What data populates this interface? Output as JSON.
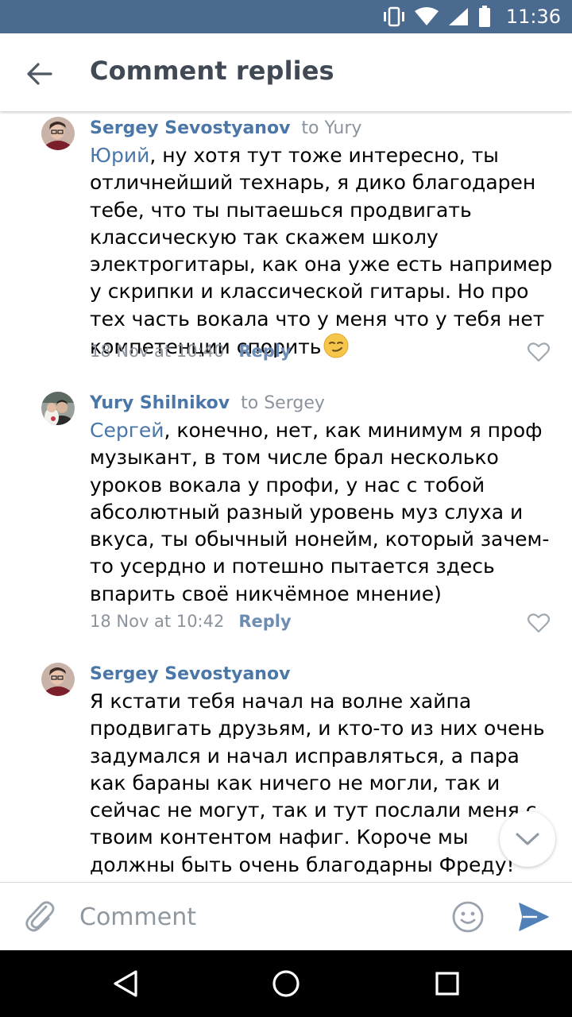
{
  "status_bar": {
    "time": "11:36",
    "background": "#4a6b8f"
  },
  "app_bar": {
    "title": "Comment replies",
    "back_icon": "arrow-left-icon"
  },
  "comments": [
    {
      "author": "Sergey Sevostyanov",
      "to": "to Yury",
      "mention": "Юрий",
      "text": ", ну хотя тут тоже интересно, ты отличнейший технарь, я дико благодарен тебе, что ты пытаешься продвигать классическую так скажем школу электрогитары, как она уже есть например у скрипки и классической гитары. Но про тех часть вокала что у меня что у тебя нет компетенции спорить",
      "emoji": "smirking-face-emoji",
      "date": "18 Nov at 10:40",
      "reply_label": "Reply"
    },
    {
      "author": "Yury Shilnikov",
      "to": "to Sergey",
      "mention": "Сергей",
      "text": ", конечно, нет, как минимум я проф музыкант, в том числе брал несколько уроков вокала у профи, у нас с тобой абсолютный разный уровень муз слуха и вкуса, ты обычный нонейм, который зачем-то усердно и потешно пытается здесь впарить своё никчёмное мнение)",
      "date": "18 Nov at 10:42",
      "reply_label": "Reply"
    },
    {
      "author": "Sergey Sevostyanov",
      "text": "Я кстати тебя начал на волне хайпа продвигать друзьям, и кто-то из них очень задумался и начал исправляться, а пара как бараны как ничего не могли, так и сейчас не могут, так и тут послали меня с твоим контентом нафиг. Короче мы должны быть очень благодарны Фреду!"
    }
  ],
  "composer": {
    "placeholder": "Comment",
    "attach_icon": "paperclip-icon",
    "emoji_icon": "smiley-icon",
    "send_icon": "send-icon"
  },
  "colors": {
    "link": "#4a76a8",
    "muted": "#8b939c",
    "send": "#5181b8"
  }
}
